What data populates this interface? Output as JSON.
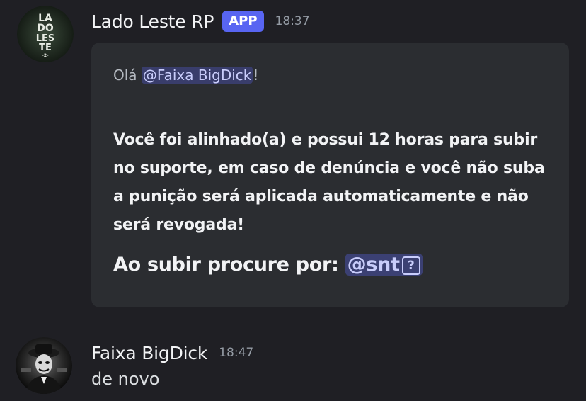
{
  "messages": [
    {
      "username": "Lado Leste RP",
      "badge": "APP",
      "time": "18:37",
      "avatar_icon": "lado-leste-logo",
      "avatar_text": [
        "LA",
        "DO",
        "LES",
        "TE",
        "-2-"
      ],
      "embed": {
        "greeting_prefix": "Olá ",
        "greeting_mention": "@Faixa BigDick",
        "greeting_suffix": "!",
        "body": "Você foi alinhado(a) e possui 12 horas para subir no suporte, em caso de denúncia e você não suba a punição será aplicada automaticamente e não será revogada!",
        "procure_label": "Ao subir procure por: ",
        "procure_mention": "@snt",
        "procure_icon": "?"
      }
    },
    {
      "username": "Faixa BigDick",
      "time": "18:47",
      "avatar_icon": "masked-figure-avatar",
      "text": "de novo"
    }
  ],
  "colors": {
    "background": "#1f1f24",
    "embed": "#2b2d31",
    "badge": "#5865f2",
    "mention_text": "#c9cdfb",
    "timestamp": "#949ba4"
  }
}
